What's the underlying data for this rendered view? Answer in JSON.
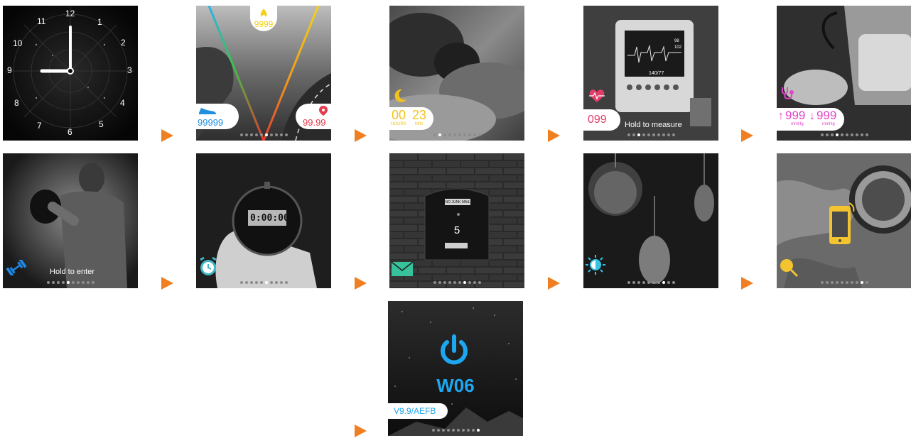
{
  "colors": {
    "arrow": "#f07f22",
    "steps_blue": "#1f8fe0",
    "calorie_yellow": "#f2d21a",
    "distance_red": "#e53a4b",
    "sleep_yellow": "#f3c219",
    "heart_pink": "#e23d69",
    "bp_magenta": "#e046c9",
    "fitness_blue": "#1e88e5",
    "timer_teal": "#3fb6c6",
    "message_green": "#37c29b",
    "brightness_cyan": "#35c4e3",
    "find_yellow": "#f3c330",
    "power_blue": "#1ea6f0"
  },
  "clock": {
    "numbers": [
      "12",
      "1",
      "2",
      "3",
      "4",
      "5",
      "6",
      "7",
      "8",
      "9",
      "10",
      "11"
    ],
    "hand_icon": "clock-hands-icon"
  },
  "activity": {
    "calories": "9999",
    "steps": "99999",
    "distance": "99.99",
    "icons": [
      "flame-icon",
      "shoe-icon",
      "location-pin-icon"
    ]
  },
  "sleep": {
    "hours": "00",
    "minutes": "23",
    "hours_label": "HOURS",
    "minutes_label": "MIN",
    "icon": "moon-icon"
  },
  "heart_rate": {
    "value": "099",
    "hint": "Hold to measure",
    "monitor_readings": [
      "98",
      "102",
      "140/77"
    ],
    "icon": "heart-pulse-icon"
  },
  "blood_pressure": {
    "systolic": "999",
    "diastolic": "999",
    "unit": "mmHg",
    "icon": "stethoscope-icon"
  },
  "fitness": {
    "hint": "Hold to enter",
    "icon": "dumbbell-icon"
  },
  "stopwatch": {
    "display": "0:00:00",
    "icon": "alarm-clock-icon"
  },
  "messages": {
    "count": "5",
    "mailbox_sign": "NO JUNK MAIL",
    "icon": "envelope-icon"
  },
  "brightness": {
    "icon": "brightness-icon"
  },
  "find_phone": {
    "icons": [
      "phone-icon",
      "magnifier-icon"
    ]
  },
  "power": {
    "model": "W06",
    "version": "V9.9/AEFB",
    "icon": "power-icon"
  },
  "pagination": {
    "total_dots": 10,
    "active": {
      "activity": 5,
      "sleep": 1,
      "heart_rate": 2,
      "blood_pressure": 3,
      "fitness": 4,
      "stopwatch": 5,
      "messages": 6,
      "brightness": 7,
      "find_phone": 8,
      "power": 9
    }
  }
}
